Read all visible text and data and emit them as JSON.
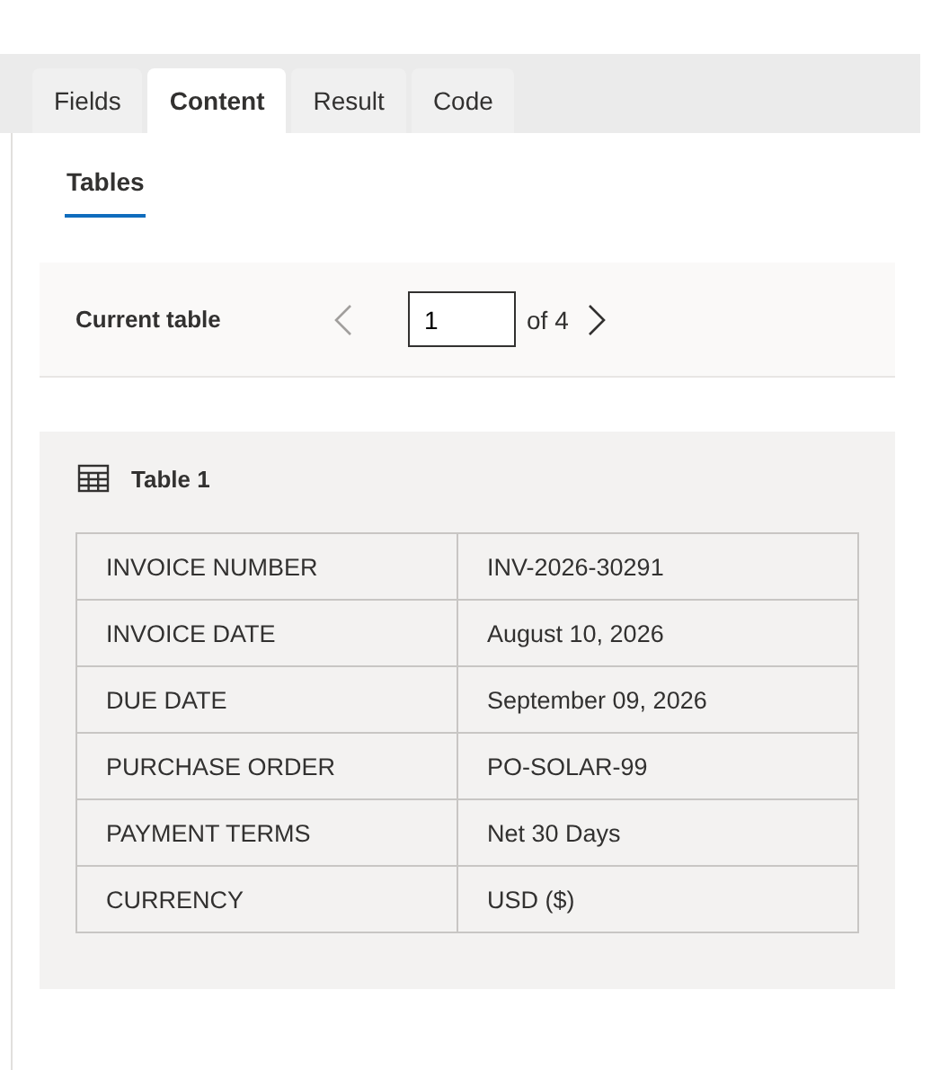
{
  "tabs": [
    {
      "label": "Fields",
      "selected": false
    },
    {
      "label": "Content",
      "selected": true
    },
    {
      "label": "Result",
      "selected": false
    },
    {
      "label": "Code",
      "selected": false
    }
  ],
  "subtabs": [
    {
      "label": "Tables",
      "selected": true
    }
  ],
  "pager": {
    "label": "Current table",
    "value": "1",
    "total": "of 4",
    "prev_disabled": true,
    "next_disabled": false
  },
  "table": {
    "title": "Table 1",
    "rows": [
      {
        "key": "INVOICE NUMBER",
        "value": "INV-2026-30291"
      },
      {
        "key": "INVOICE DATE",
        "value": "August 10, 2026"
      },
      {
        "key": "DUE DATE",
        "value": "September 09, 2026"
      },
      {
        "key": "PURCHASE ORDER",
        "value": "PO-SOLAR-99"
      },
      {
        "key": "PAYMENT TERMS",
        "value": "Net 30 Days"
      },
      {
        "key": "CURRENCY",
        "value": "USD ($)"
      }
    ]
  }
}
